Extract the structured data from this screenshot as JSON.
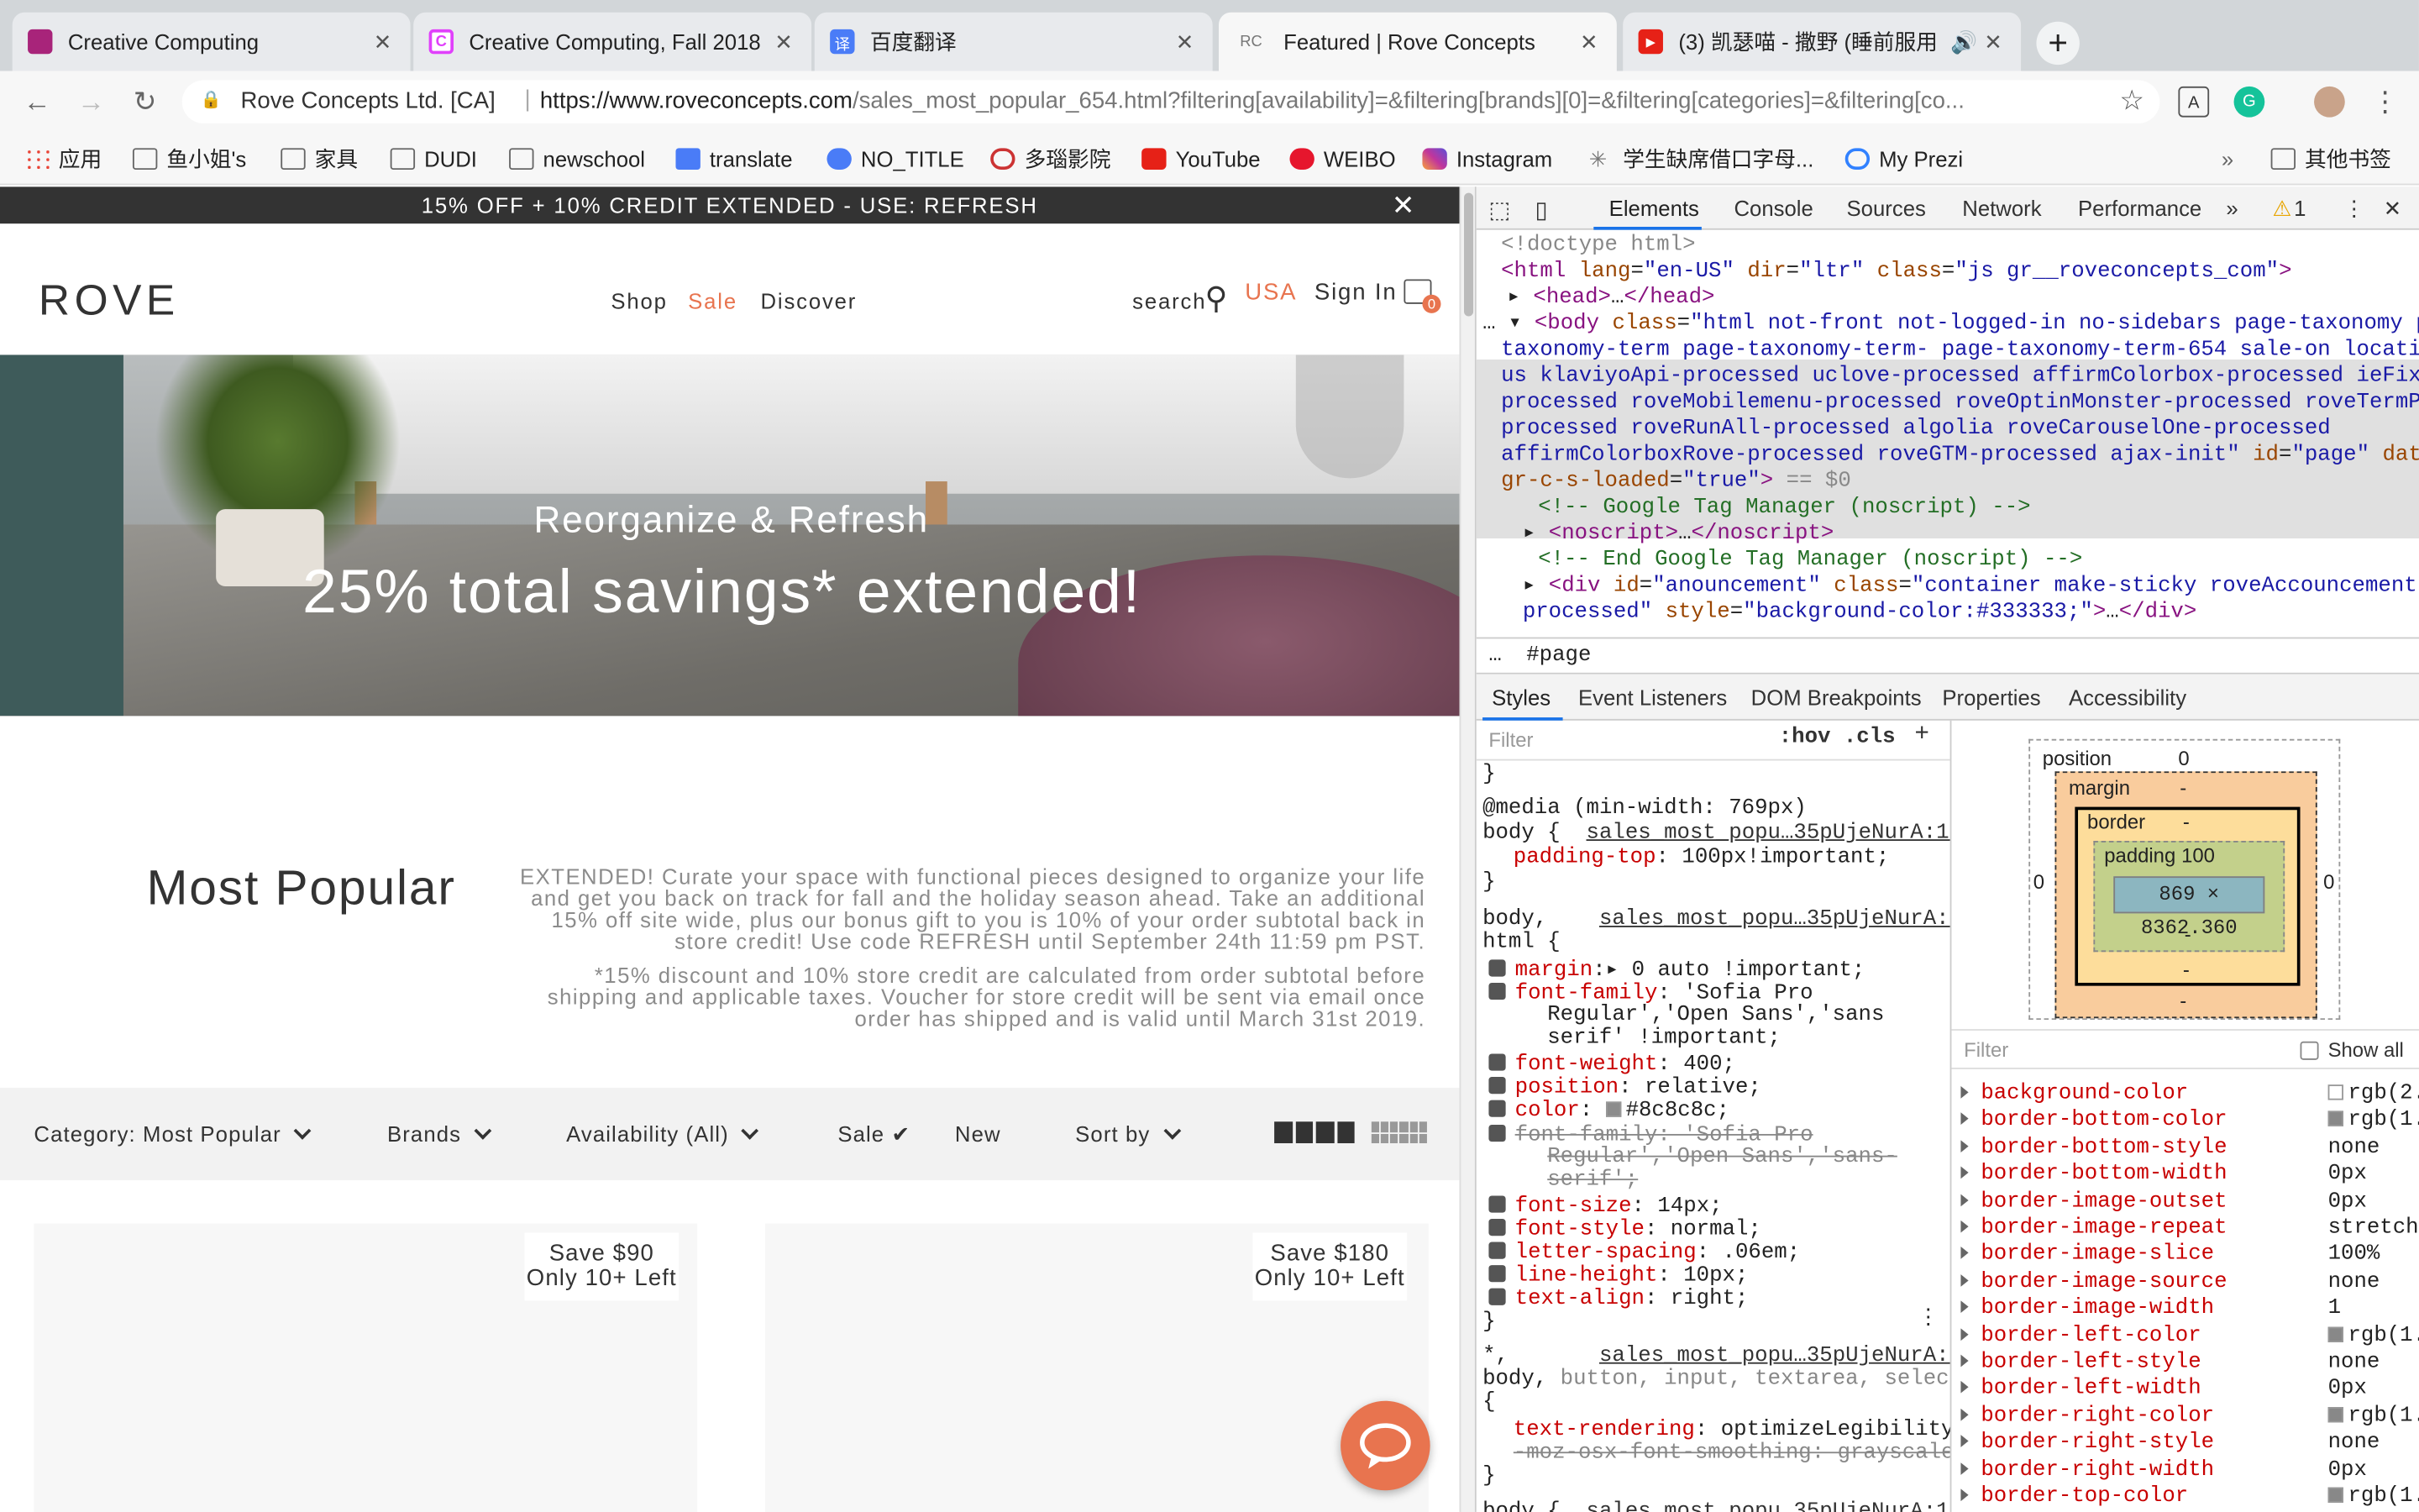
{
  "tabs": [
    {
      "title": "Creative Computing",
      "color": "#a8247a",
      "glyph": ""
    },
    {
      "title": "Creative Computing, Fall 2018",
      "color": "#e040fb",
      "glyph": "C"
    },
    {
      "title": "百度翻译",
      "color": "#4a7cf7",
      "glyph": "译"
    },
    {
      "title": "Featured | Rove Concepts",
      "color": "#999",
      "glyph": "RC"
    },
    {
      "title": "(3) 凯瑟喵 - 撒野 (睡前服用",
      "color": "#e62117",
      "glyph": "▶"
    }
  ],
  "address": {
    "site": "Rove Concepts Ltd. [CA]",
    "url_domain": "https://www.roveconcepts.com",
    "url_path": "/sales_most_popular_654.html?filtering[availability]=&filtering[brands][0]=&filtering[categories]=&filtering[co..."
  },
  "bookmarks": [
    "应用",
    "鱼小姐's",
    "家具",
    "DUDI",
    "newschool",
    "translate",
    "NO_TITLE",
    "多瑙影院",
    "YouTube",
    "WEIBO",
    "Instagram",
    "学生缺席借口字母...",
    "My Prezi",
    "其他书签"
  ],
  "site": {
    "announcement": "15% OFF + 10% CREDIT EXTENDED - USE: REFRESH",
    "logo": "ROVE",
    "nav": {
      "shop": "Shop",
      "sale": "Sale",
      "discover": "Discover",
      "search": "search",
      "region": "USA",
      "signin": "Sign In",
      "cart_count": "0"
    },
    "hero": {
      "line1": "Reorganize & Refresh",
      "line2": "25% total savings* extended!"
    },
    "most_popular": {
      "title": "Most Popular",
      "para1": "EXTENDED! Curate your space with functional pieces designed to organize your life and get you back on track for fall and the holiday season ahead. Take an additional 15% off site wide, plus our bonus gift to you is 10% of your order subtotal back in store credit! Use code REFRESH until September 24th 11:59 pm PST.",
      "para2": "*15% discount and 10% store credit are calculated from order subtotal before shipping and applicable taxes. Voucher for store credit will be sent via email once order has shipped and is valid until March 31st 2019."
    },
    "filters": {
      "category": "Category: Most Popular",
      "brands": "Brands",
      "availability": "Availability (All)",
      "sale": "Sale",
      "new": "New",
      "sortby": "Sort by"
    },
    "cards": [
      {
        "save": "Save $90",
        "stock": "Only 10+ Left"
      },
      {
        "save": "Save $180",
        "stock": "Only 10+ Left"
      }
    ]
  },
  "devtools": {
    "tabs": [
      "Elements",
      "Console",
      "Sources",
      "Network",
      "Performance"
    ],
    "warnings": "1",
    "crumb": "#page",
    "panel_tabs": [
      "Styles",
      "Event Listeners",
      "DOM Breakpoints",
      "Properties",
      "Accessibility"
    ],
    "filter_placeholder": "Filter",
    "hov": ":hov",
    "cls": ".cls",
    "box": {
      "position": "position",
      "position_val": "0",
      "margin": "margin",
      "border": "border",
      "padding": "padding",
      "padding_val": "100",
      "content": "869 × 8362.360",
      "dash": "-",
      "zero": "0"
    },
    "show_all": "Show all",
    "computed": [
      {
        "k": "background-color",
        "v": "rgb(2..."
      },
      {
        "k": "border-bottom-color",
        "v": "rgb(1..."
      },
      {
        "k": "border-bottom-style",
        "v": "none"
      },
      {
        "k": "border-bottom-width",
        "v": "0px"
      },
      {
        "k": "border-image-outset",
        "v": "0px"
      },
      {
        "k": "border-image-repeat",
        "v": "stretch"
      },
      {
        "k": "border-image-slice",
        "v": "100%"
      },
      {
        "k": "border-image-source",
        "v": "none"
      },
      {
        "k": "border-image-width",
        "v": "1"
      },
      {
        "k": "border-left-color",
        "v": "rgb(1..."
      },
      {
        "k": "border-left-style",
        "v": "none"
      },
      {
        "k": "border-left-width",
        "v": "0px"
      },
      {
        "k": "border-right-color",
        "v": "rgb(1..."
      },
      {
        "k": "border-right-style",
        "v": "none"
      },
      {
        "k": "border-right-width",
        "v": "0px"
      },
      {
        "k": "border-top-color",
        "v": "rgb(1..."
      }
    ]
  }
}
